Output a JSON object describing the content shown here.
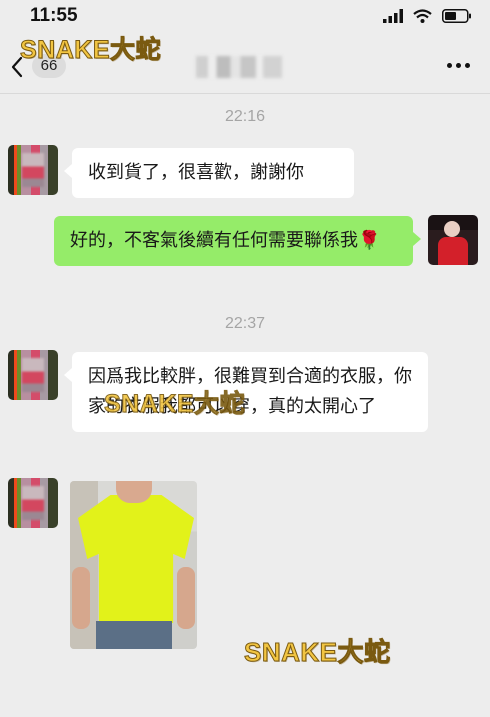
{
  "status_bar": {
    "time": "11:55"
  },
  "nav": {
    "unread_count": "66",
    "contact_name": "​"
  },
  "watermark": "SNAKE大蛇",
  "chat": {
    "timestamps": [
      "22:16",
      "22:37"
    ],
    "messages": [
      {
        "side": "left",
        "text": "收到貨了，很喜歡，謝謝你"
      },
      {
        "side": "right",
        "text": "好的，不客氣後續有任何需要聯係我🌹"
      },
      {
        "side": "left",
        "text": "因爲我比較胖，很難買到合適的衣服，你家的衣服我都可以穿，真的太開心了"
      }
    ]
  },
  "colors": {
    "background": "#ededed",
    "bubble_self": "#95ec69",
    "bubble_other": "#ffffff",
    "timestamp": "#a5a5a5",
    "watermark": "#f2c542"
  },
  "icons": [
    "signal-icon",
    "wifi-icon",
    "battery-icon",
    "back-chevron-icon",
    "more-icon"
  ]
}
